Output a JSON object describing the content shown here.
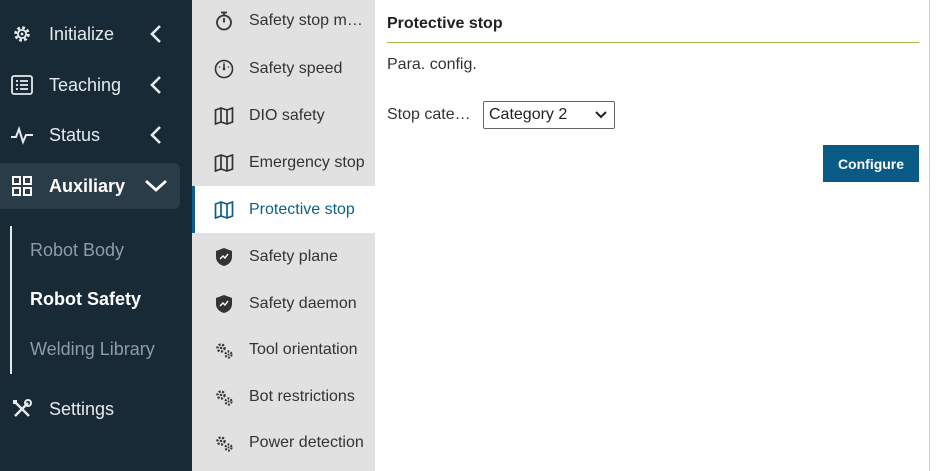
{
  "nav": {
    "items": [
      {
        "label": "Initialize",
        "icon": "gear-icon"
      },
      {
        "label": "Teaching",
        "icon": "list-icon"
      },
      {
        "label": "Status",
        "icon": "pulse-icon"
      },
      {
        "label": "Auxiliary",
        "icon": "grid-icon"
      },
      {
        "label": "Settings",
        "icon": "wrench-icon"
      }
    ],
    "sub_items": [
      {
        "label": "Robot Body"
      },
      {
        "label": "Robot Safety"
      },
      {
        "label": "Welding Library"
      }
    ]
  },
  "menu": {
    "items": [
      {
        "label": "Safety stop mode",
        "icon": "stopwatch-icon"
      },
      {
        "label": "Safety speed",
        "icon": "gauge-icon"
      },
      {
        "label": "DIO safety",
        "icon": "map-icon"
      },
      {
        "label": "Emergency stop",
        "icon": "map-icon"
      },
      {
        "label": "Protective stop",
        "icon": "map-icon"
      },
      {
        "label": "Safety plane",
        "icon": "shield-icon"
      },
      {
        "label": "Safety daemon",
        "icon": "shield-icon"
      },
      {
        "label": "Tool orientation",
        "icon": "gears-icon"
      },
      {
        "label": "Bot restrictions",
        "icon": "gears-icon"
      },
      {
        "label": "Power detection",
        "icon": "gears-icon"
      }
    ]
  },
  "content": {
    "title": "Protective stop",
    "section": "Para. config.",
    "stop_category_label": "Stop category",
    "stop_category_value": "Category 2",
    "configure_label": "Configure"
  },
  "colors": {
    "nav_bg": "#172a35",
    "accent": "#0d5f8a",
    "title_rule": "#9bbd4a",
    "button": "#0a5a86"
  }
}
